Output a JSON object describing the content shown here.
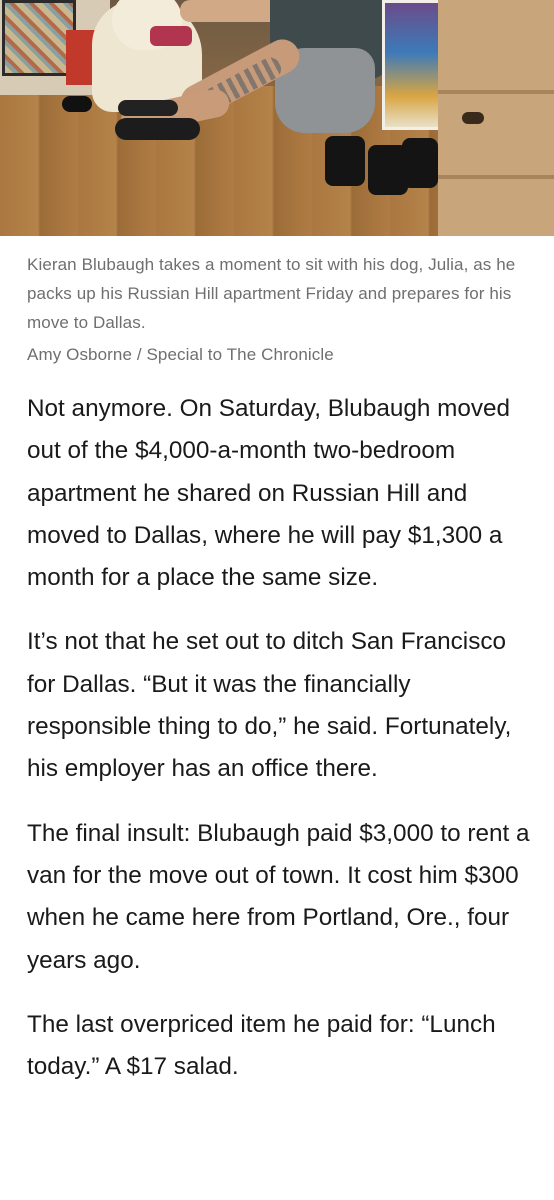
{
  "photo": {
    "alt_icon": "photo-image"
  },
  "caption": {
    "text": "Kieran Blubaugh takes a moment to sit with his dog, Julia, as he packs up his Russian Hill apartment Friday and prepares for his move to Dallas.",
    "credit": "Amy Osborne / Special to The Chronicle"
  },
  "article": {
    "paragraphs": [
      "Not anymore. On Saturday, Blubaugh moved out of the $4,000-a-month two-bedroom apartment he shared on Russian Hill and moved to Dallas, where he will pay $1,300 a month for a place the same size.",
      "It’s not that he set out to ditch San Francisco for Dallas. “But it was the financially responsible thing to do,” he said. Fortunately, his employer has an office there.",
      "The final insult: Blubaugh paid $3,000 to rent a van for the move out of town. It cost him $300 when he came here from Portland, Ore., four years ago.",
      "The last overpriced item he paid for: “Lunch today.” A $17 salad."
    ]
  }
}
